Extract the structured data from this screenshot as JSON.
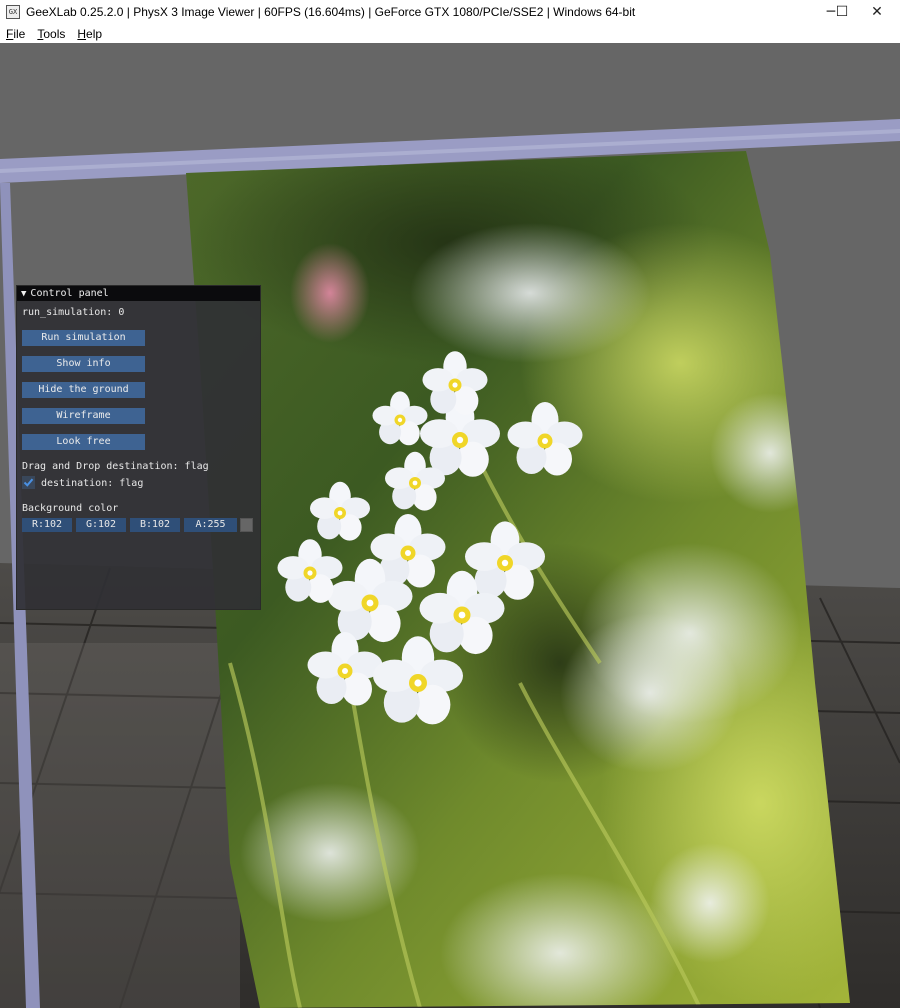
{
  "window": {
    "app_icon_text": "GX",
    "title": "GeeXLab 0.25.2.0 | PhysX 3 Image Viewer | 60FPS (16.604ms) | GeForce GTX 1080/PCIe/SSE2 | Windows 64-bit",
    "minimize_glyph": "─",
    "maximize_glyph": "☐",
    "close_glyph": "✕"
  },
  "menu": {
    "file": {
      "hotkey": "F",
      "rest": "ile"
    },
    "tools": {
      "hotkey": "T",
      "rest": "ools"
    },
    "help": {
      "hotkey": "H",
      "rest": "elp"
    }
  },
  "panel": {
    "title": "Control panel",
    "arrow": "▼",
    "run_simulation_text": "run_simulation: 0",
    "buttons": {
      "run_simulation": "Run simulation",
      "show_info": "Show info",
      "hide_ground": "Hide the ground",
      "wireframe": "Wireframe",
      "look_free": "Look free"
    },
    "drag_drop_text": "Drag and Drop destination: flag",
    "checkbox_label": "destination: flag",
    "checkbox_checked": true,
    "background_label": "Background color",
    "bg_color": {
      "r": "R:102",
      "g": "G:102",
      "b": "B:102",
      "a": "A:255",
      "swatch": "#666666"
    },
    "accent_button": "#3e6392",
    "accent_checkmark": "#4a90e2"
  }
}
